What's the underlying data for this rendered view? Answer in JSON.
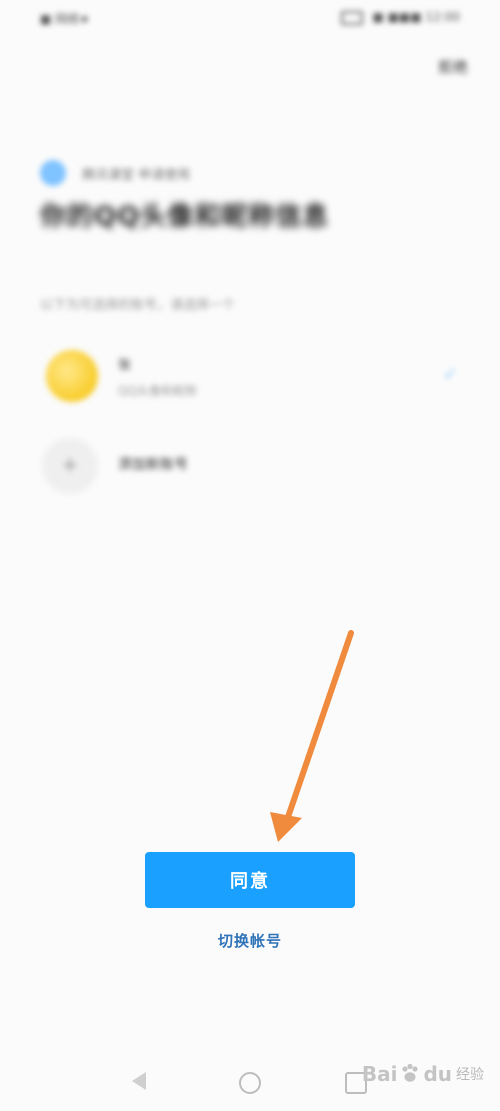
{
  "status_bar": {
    "left": "■ 网络★",
    "right": "■ ■■■ 12:00"
  },
  "header": {
    "top_right": "拒绝"
  },
  "auth": {
    "brand": "腾讯课堂 申请使用",
    "title": "你的QQ头像和昵称信息",
    "subtitle": "以下为可选择的账号，请选择一个",
    "accounts": [
      {
        "name": "张",
        "sub": "QQ头像和昵称",
        "icon": "avatar-yellow-icon"
      }
    ],
    "new_account_label": "添加新账号",
    "new_account_icon": "plus-icon"
  },
  "actions": {
    "agree_label": "同意",
    "switch_account_label": "切换帐号"
  },
  "nav_bar": {
    "icons": [
      "back-triangle-icon",
      "home-circle-icon",
      "recent-square-icon"
    ]
  },
  "watermark": {
    "text_a": "Bai",
    "text_b": "du",
    "text_c": "经验"
  },
  "colors": {
    "primary": "#1aa0ff",
    "link": "#2f73b8",
    "arrow": "#f08a3c"
  }
}
